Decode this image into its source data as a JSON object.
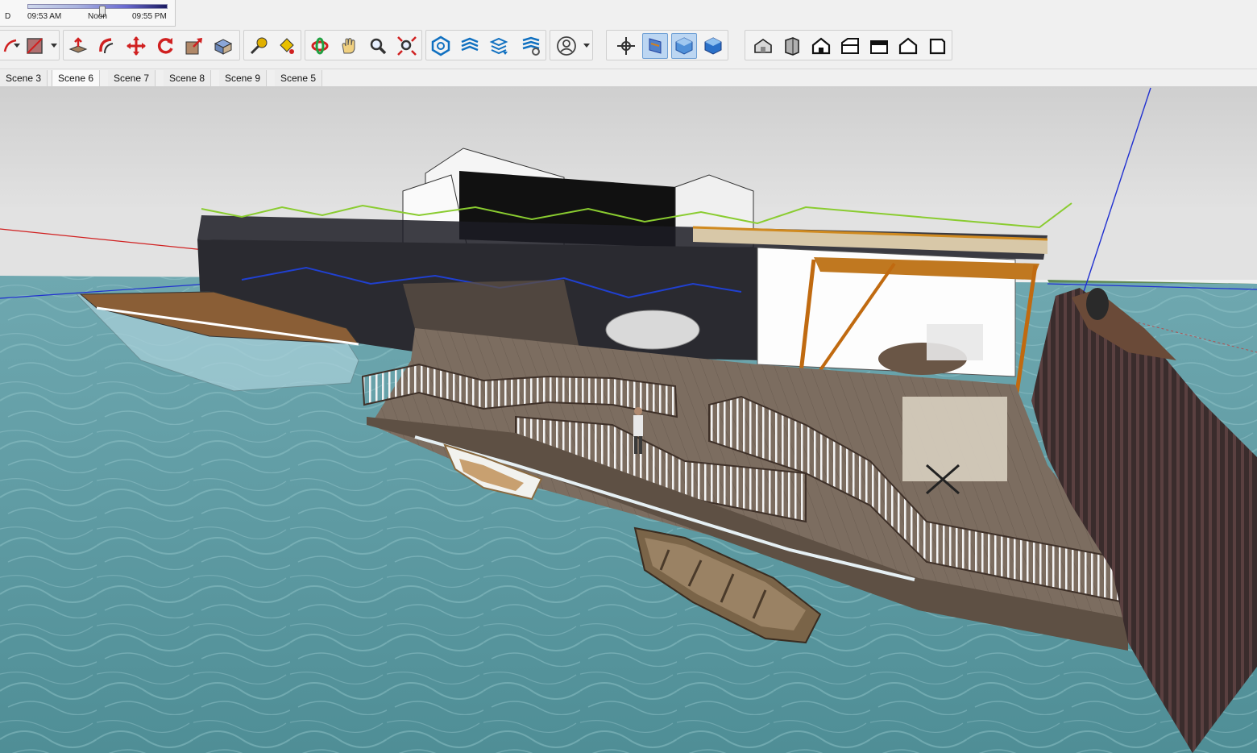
{
  "shadow_settings": {
    "left_label": "D",
    "start_time": "09:53 AM",
    "mid_time": "Noon",
    "end_time": "09:55 PM"
  },
  "toolbar": {
    "groups": [
      {
        "name": "drawing-tools",
        "icons": [
          "pencil-arc-icon",
          "eraser-square-icon"
        ]
      },
      {
        "name": "edit-tools",
        "icons": [
          "push-pull-icon",
          "follow-me-icon",
          "move-icon",
          "rotate-icon",
          "scale-icon",
          "offset-icon"
        ]
      },
      {
        "name": "construction-tools",
        "icons": [
          "tape-measure-icon",
          "paint-bucket-icon"
        ]
      },
      {
        "name": "camera-tools",
        "icons": [
          "orbit-icon",
          "pan-hand-icon",
          "zoom-icon",
          "zoom-extents-icon"
        ]
      },
      {
        "name": "warehouse-tools",
        "icons": [
          "components-icon",
          "layers-icon",
          "styles-icon",
          "extension-icon"
        ]
      },
      {
        "name": "account-tools",
        "icons": [
          "user-account-icon"
        ]
      },
      {
        "name": "section-tools",
        "icons": [
          "section-plane-icon",
          "display-section-planes-icon",
          "display-section-cuts-icon",
          "section-fill-icon"
        ]
      },
      {
        "name": "view-tools",
        "icons": [
          "iso-view-icon",
          "top-view-icon",
          "front-view-icon",
          "right-view-icon",
          "back-view-icon",
          "left-view-icon",
          "bottom-view-icon"
        ]
      }
    ]
  },
  "scenes": {
    "tabs": [
      "Scene 3",
      "Scene 6",
      "Scene 7",
      "Scene 8",
      "Scene 9",
      "Scene 5"
    ],
    "active": "Scene 6"
  },
  "colors": {
    "water": "#5f9aa0",
    "sky": "#e4e4e4",
    "deck": "#7a6a5c",
    "axis_red": "#d02020",
    "axis_blue": "#2030d0",
    "axis_green": "#20a040",
    "active_tool": "#bcd6f2"
  }
}
